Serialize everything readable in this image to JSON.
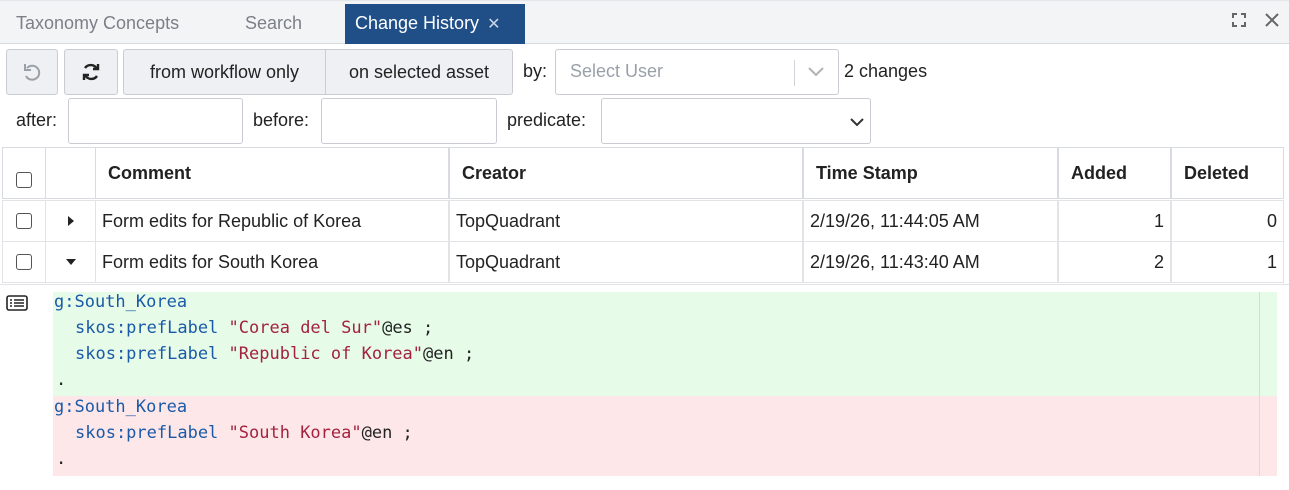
{
  "tabs": [
    {
      "label": "Taxonomy Concepts"
    },
    {
      "label": "Search"
    },
    {
      "label": "Change History",
      "close": "✕"
    }
  ],
  "toolbar": {
    "from_workflow": "from workflow only",
    "on_selected": "on selected asset",
    "by_label": "by:",
    "user_placeholder": "Select User",
    "changes_count": "2 changes",
    "after_label": "after:",
    "before_label": "before:",
    "predicate_label": "predicate:"
  },
  "table": {
    "headers": [
      "Comment",
      "Creator",
      "Time Stamp",
      "Added",
      "Deleted"
    ],
    "rows": [
      {
        "comment": "Form edits for Republic of Korea",
        "creator": "TopQuadrant",
        "timestamp": "2/19/26, 11:44:05 AM",
        "added": "1",
        "deleted": "0"
      },
      {
        "comment": "Form edits for South Korea",
        "creator": "TopQuadrant",
        "timestamp": "2/19/26, 11:43:40 AM",
        "added": "2",
        "deleted": "1"
      }
    ]
  },
  "diff": {
    "added": {
      "subject": "g:South_Korea",
      "lines": [
        {
          "pred": "skos:prefLabel",
          "lit": "\"Corea del Sur\"",
          "lang": "@es ;"
        },
        {
          "pred": "skos:prefLabel",
          "lit": "\"Republic of Korea\"",
          "lang": "@en ;"
        }
      ],
      "end": "."
    },
    "deleted": {
      "subject": "g:South_Korea",
      "lines": [
        {
          "pred": "skos:prefLabel",
          "lit": "\"South Korea\"",
          "lang": "@en ;"
        }
      ],
      "end": "."
    }
  },
  "colors": {
    "active_tab": "#1f4f86",
    "added_bg": "#e6fbe8",
    "deleted_bg": "#fde7e8",
    "keyword": "#1a5aa8",
    "literal": "#a32240"
  }
}
